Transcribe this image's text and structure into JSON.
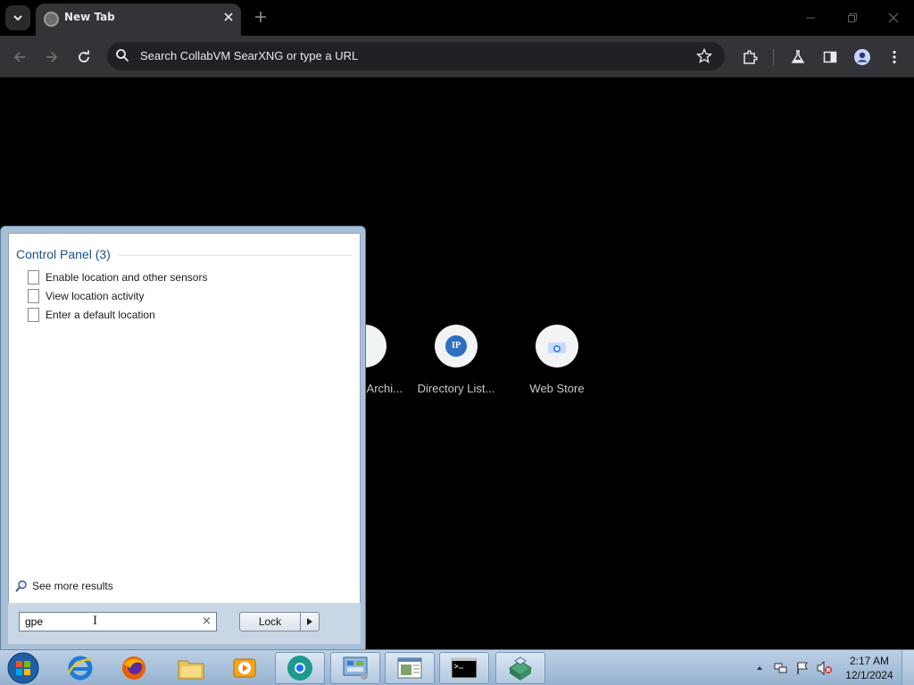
{
  "browser": {
    "tab": {
      "title": "New Tab"
    },
    "omnibox": {
      "placeholder": "Search CollabVM SearXNG or type a URL"
    },
    "shortcuts": [
      {
        "label": "Archi...",
        "icon": "archive-icon"
      },
      {
        "label": "Directory List...",
        "icon": "ip-icon",
        "glyph": "IP"
      },
      {
        "label": "Web Store",
        "icon": "web-store-icon"
      }
    ]
  },
  "start_menu": {
    "group_header": "Control Panel (3)",
    "results": [
      {
        "label": "Enable location and other sensors"
      },
      {
        "label": "View location activity"
      },
      {
        "label": "Enter a default location"
      }
    ],
    "see_more": "See more results",
    "search_value": "gpe",
    "clear_glyph": "×",
    "cursor_glyph": "I",
    "lock_label": "Lock"
  },
  "taskbar": {
    "clock": {
      "time": "2:17 AM",
      "date": "12/1/2024"
    }
  },
  "colors": {
    "chrome_bg": "#000000",
    "toolbar_bg": "#333437",
    "start_menu_header": "#1e4e8c",
    "taskbar_top": "#bcd0e6"
  }
}
